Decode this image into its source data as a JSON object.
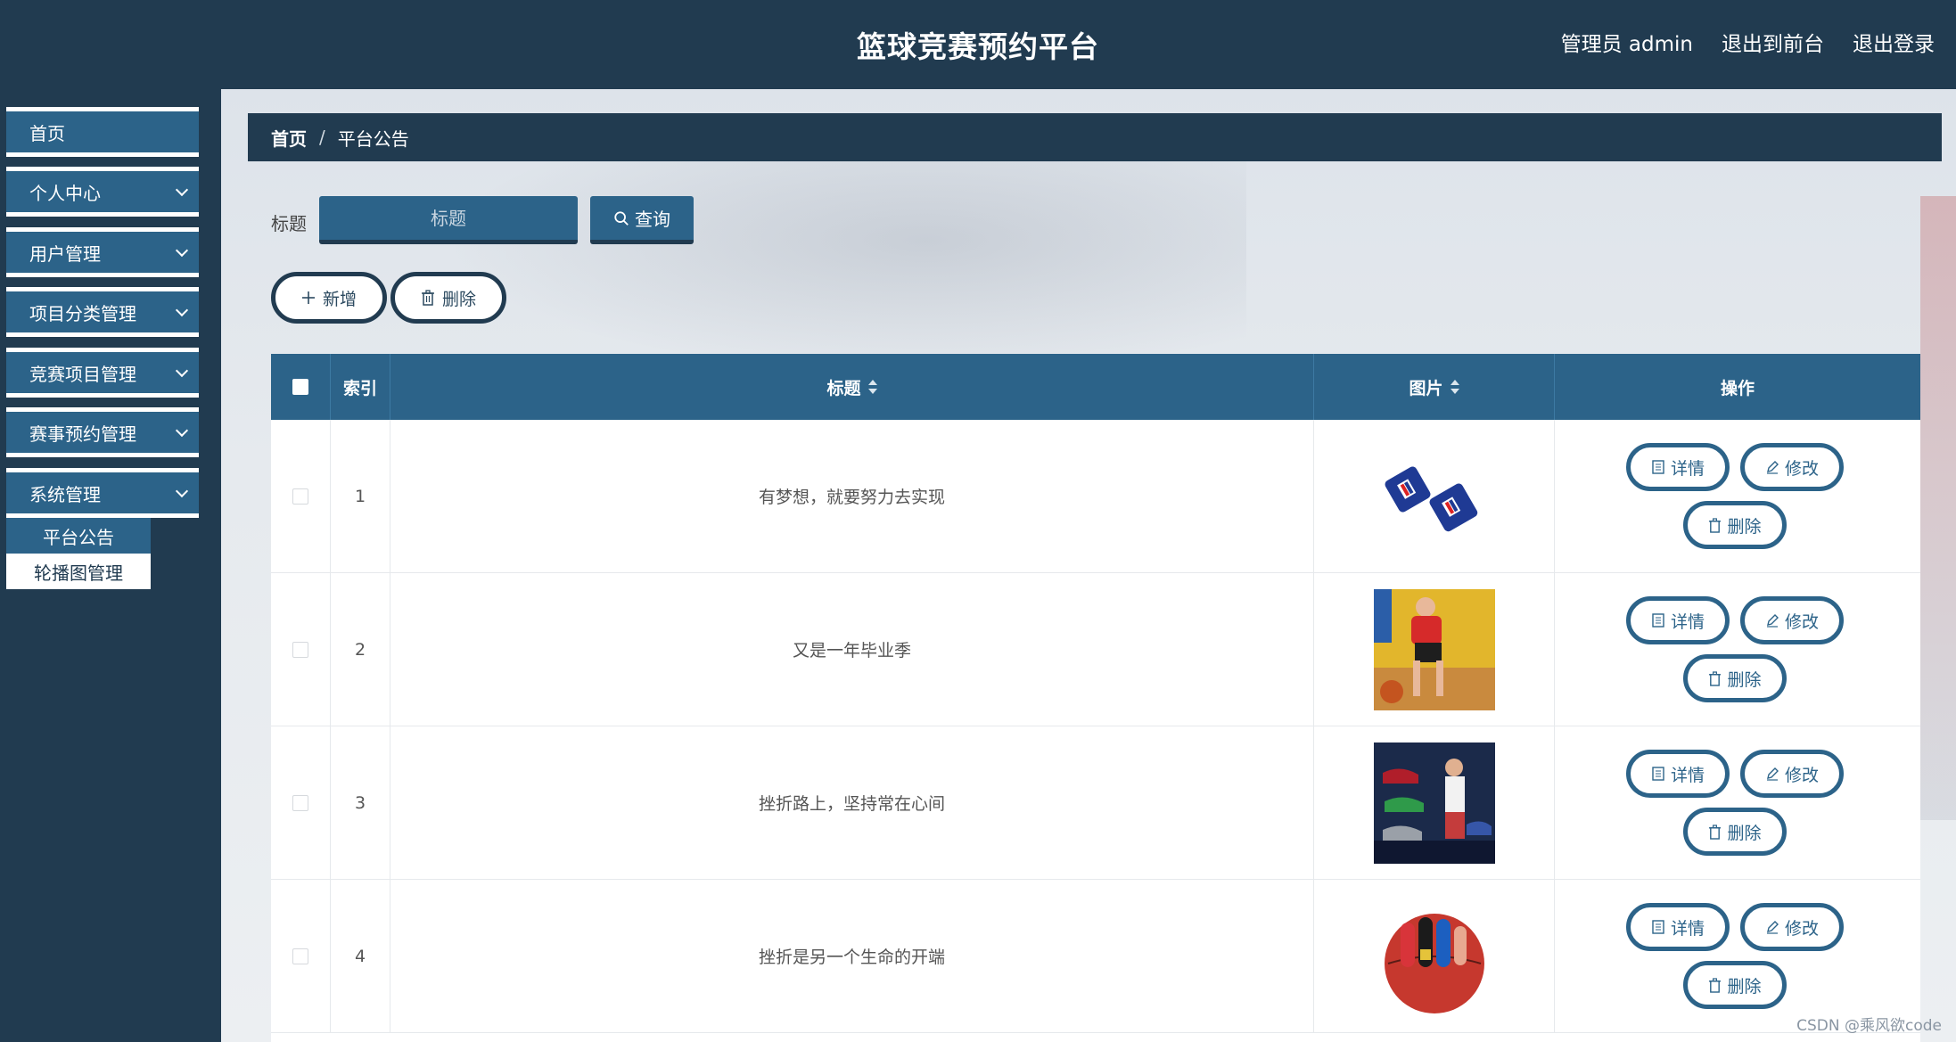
{
  "app": {
    "title": "篮球竞赛预约平台",
    "user_label": "管理员 admin",
    "to_front_label": "退出到前台",
    "logout_label": "退出登录"
  },
  "sidebar": {
    "items": [
      {
        "label": "首页"
      },
      {
        "label": "个人中心"
      },
      {
        "label": "用户管理"
      },
      {
        "label": "项目分类管理"
      },
      {
        "label": "竞赛项目管理"
      },
      {
        "label": "赛事预约管理"
      },
      {
        "label": "系统管理"
      }
    ],
    "sub_items": [
      {
        "label": "平台公告",
        "active": true
      },
      {
        "label": "轮播图管理",
        "active": false
      }
    ]
  },
  "breadcrumb": {
    "home": "首页",
    "separator": "/",
    "current": "平台公告"
  },
  "search": {
    "label": "标题",
    "placeholder": "标题",
    "value": "",
    "button_label": "查询"
  },
  "toolbar": {
    "add_label": "新增",
    "delete_label": "删除"
  },
  "table": {
    "columns": {
      "index": "索引",
      "title": "标题",
      "image": "图片",
      "actions": "操作"
    },
    "rows": [
      {
        "index": "1",
        "title": "有梦想，就要努力去实现",
        "image": "wristband-image"
      },
      {
        "index": "2",
        "title": "又是一年毕业季",
        "image": "player-dribbling-image"
      },
      {
        "index": "3",
        "title": "挫折路上，坚持常在心间",
        "image": "sneakers-poster-image"
      },
      {
        "index": "4",
        "title": "挫折是另一个生命的开端",
        "image": "finger-sleeves-basketball-image"
      }
    ],
    "actions": {
      "detail": "详情",
      "edit": "修改",
      "delete": "删除"
    }
  },
  "watermark": "CSDN @乘风欲code",
  "colors": {
    "header_bg": "#213b50",
    "accent": "#2c6389",
    "content_bg": "#e9edf1"
  }
}
